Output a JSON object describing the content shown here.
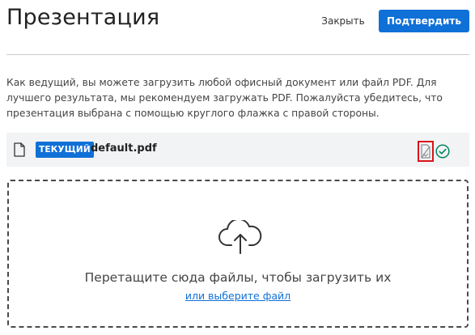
{
  "header": {
    "title": "Презентация",
    "close_label": "Закрыть",
    "confirm_label": "Подтвердить"
  },
  "description": "Как ведущий, вы можете загрузить любой офисный документ или файл PDF. Для лучшего результата, мы рекомендуем загружать PDF. Пожалуйста убедитесь, что презентация выбрана с помощью круглого флажка с правой стороны.",
  "file": {
    "badge": "ТЕКУЩИЙ",
    "name": "default.pdf",
    "icons": [
      "document-icon",
      "download-toggle-icon",
      "check-circle-icon"
    ]
  },
  "dropzone": {
    "icon": "cloud-upload-icon",
    "text": "Перетащите сюда файлы, чтобы загрузить их",
    "link": "или выберите файл"
  },
  "colors": {
    "accent": "#0f70d7",
    "highlight": "#d9141a",
    "check": "#00875a"
  }
}
